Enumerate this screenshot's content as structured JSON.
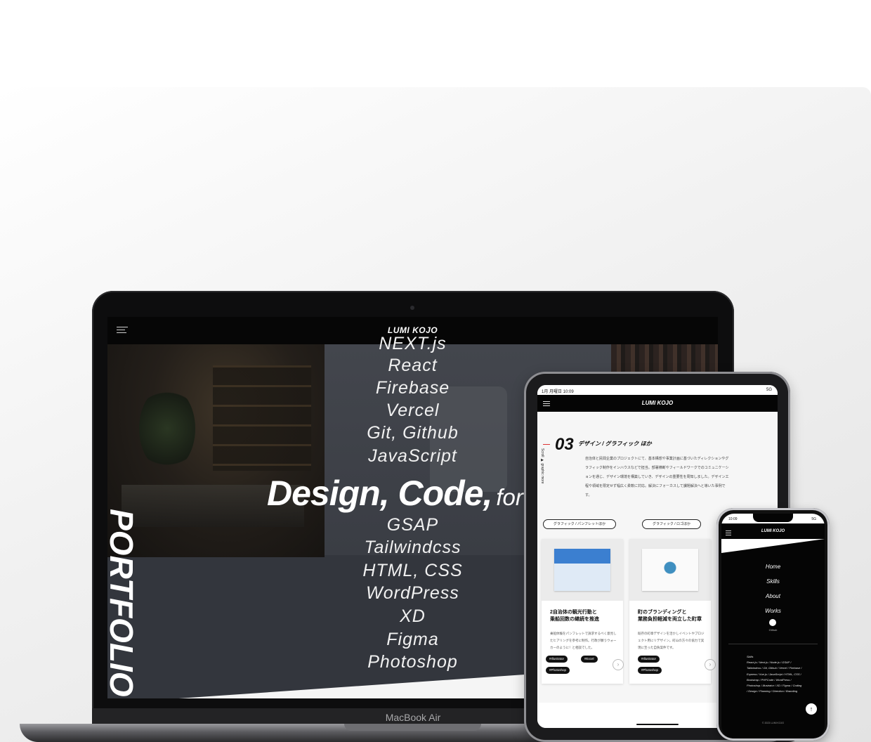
{
  "laptop": {
    "site_logo": "LUMI KOJO",
    "skills_top": [
      "NEXT.js",
      "React",
      "Firebase",
      "Vercel",
      "Git, Github",
      "JavaScript"
    ],
    "hero_big": "Design, Code,",
    "hero_small": "for Solu",
    "skills_bottom": [
      "GSAP",
      "Tailwindcss",
      "HTML, CSS",
      "WordPress",
      "XD",
      "Figma",
      "Photoshop"
    ],
    "side_title": "PORTFOLIO",
    "device_label": "MacBook Air"
  },
  "tablet": {
    "status_time": "1月 月曜日 10:09",
    "status_signal": "5G",
    "site_logo": "LUMI KOJO",
    "section_number": "03",
    "section_title": "デザイン / グラフィック ほか",
    "side_label": "Scroll ▶ graphic more",
    "section_body": "自治体と民間企業のプロジェクトにて、基本構想や事業計画に基づいたディレクションやグラフィック制作をインハウスなどで担当。部署横断やフィールドワークでのコミュニケーションを通じ、デザイン環境を構築していき、デザインの重要性を周知しました。デザイン工程や領域を限定せず幅広く柔軟に対応。解決にフォーカスして課題解決へと導いた事例です。",
    "pills": [
      "グラフィック / パンフレットほか",
      "グラフィック / ロゴほか"
    ],
    "cards": [
      {
        "title": "2自治体の観光行動と\n乗船回数の継続を推進",
        "desc": "乗船体験をパンフレットで訴求するべく意見したヒアリングを参考に制作。行政が願うウォーカーのように！と相談でした。",
        "tags": [
          "#Illustrator",
          "#Excel",
          "#Photoshop"
        ]
      },
      {
        "title": "町のブランディングと\n業務負担軽減を両立した町章",
        "desc": "既存の町章デザインを活かしイベントやプロジェクト用にリデザイン。町山の方々の協力で実現に至った自負案件です。",
        "tags": [
          "#Illustrator",
          "#Photoshop"
        ]
      }
    ]
  },
  "phone": {
    "status_time": "10:09",
    "status_signal": "5G",
    "site_logo": "LUMI KOJO",
    "nav": [
      "Home",
      "Skills",
      "About",
      "Works"
    ],
    "github_label": "Github",
    "skills_text": "Skills\nReact.js / Next.js / Node.js / GSAP / Tailwindcss / Git, Github / Vercel / Firebase / Express / Vue.js / JavaScript / HTML, CSS / Bootstrap / PHPCode / WordPress / Photoshop / Illustrator / XD / Figma / Coding / Design / Planning / Direction / Branding",
    "copyright": "© 2023 LUMI KOJO"
  },
  "colors": {
    "screen_bg": "#33363d",
    "header_bg": "#060606",
    "accent_red": "#dd3333"
  }
}
